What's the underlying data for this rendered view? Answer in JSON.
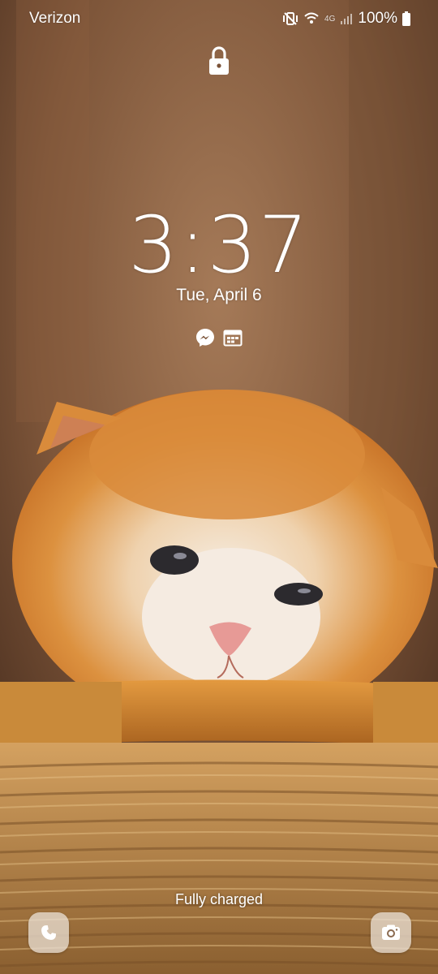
{
  "status_bar": {
    "carrier": "Verizon",
    "network": "4G",
    "battery_percent": "100%"
  },
  "lock_screen": {
    "time": "3:37",
    "date": "Tue, April 6",
    "notifications": [
      "messenger-icon",
      "calendar-icon"
    ],
    "charging_status": "Fully charged"
  },
  "shortcuts": {
    "left": "phone-icon",
    "right": "camera-icon"
  },
  "wallpaper": {
    "subject": "orange-white-kitten-in-wicker-basket",
    "colors": {
      "background": "#7a5238",
      "fur_orange": "#d88a3a",
      "fur_white": "#f4ebe0",
      "basket": "#c99a5a"
    }
  }
}
